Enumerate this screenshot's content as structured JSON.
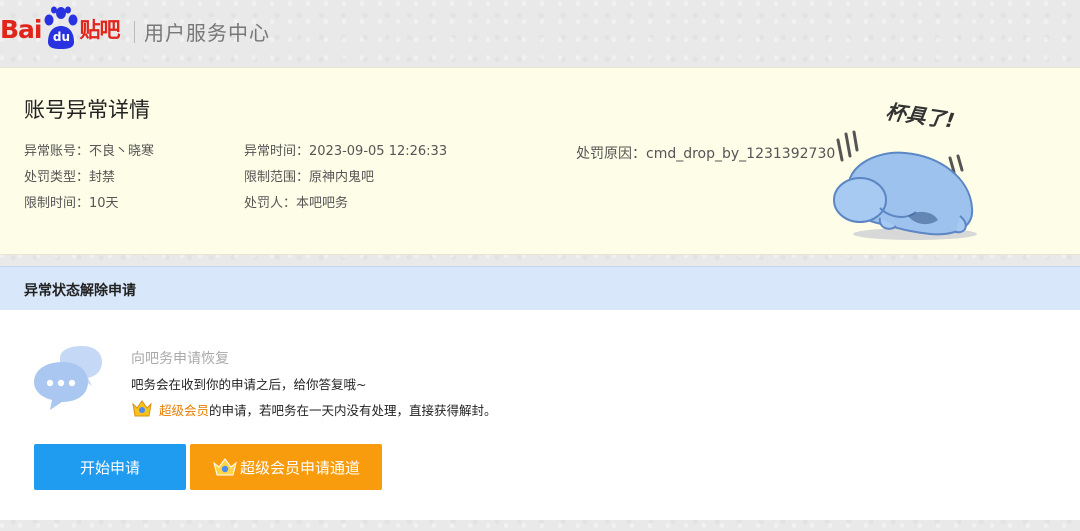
{
  "header": {
    "logo_bai": "Bai",
    "logo_du": "du",
    "logo_tieba": "贴吧",
    "title": "用户服务中心"
  },
  "account": {
    "title": "账号异常详情",
    "fields": {
      "account": {
        "label": "异常账号：",
        "value": "不良丶晓寒"
      },
      "time": {
        "label": "异常时间：",
        "value": "2023-09-05 12:26:33"
      },
      "reason": {
        "label": "处罚原因：",
        "value": "cmd_drop_by_1231392730"
      },
      "penalty": {
        "label": "处罚类型：",
        "value": "封禁"
      },
      "scope": {
        "label": "限制范围：",
        "value": "原神内鬼吧"
      },
      "duration": {
        "label": "限制时间：",
        "value": "10天"
      },
      "punisher": {
        "label": "处罚人：",
        "value": "本吧吧务"
      }
    },
    "mascot_text": "杯具了!"
  },
  "appeal": {
    "header": "异常状态解除申请",
    "subtitle": "向吧务申请恢复",
    "desc": "吧务会在收到你的申请之后，给你答复哦~",
    "vip_highlight": "超级会员",
    "vip_rest": "的申请，若吧务在一天内没有处理，直接获得解封。",
    "start_button": "开始申请",
    "vip_button": "超级会员申请通道"
  },
  "colors": {
    "brand_red": "#e1251b",
    "brand_blue": "#2932e1",
    "card_bg": "#fdfde8",
    "section_header_bg": "#d9e7fb",
    "primary_button": "#1f9bf0",
    "vip_button": "#f89c0e"
  }
}
